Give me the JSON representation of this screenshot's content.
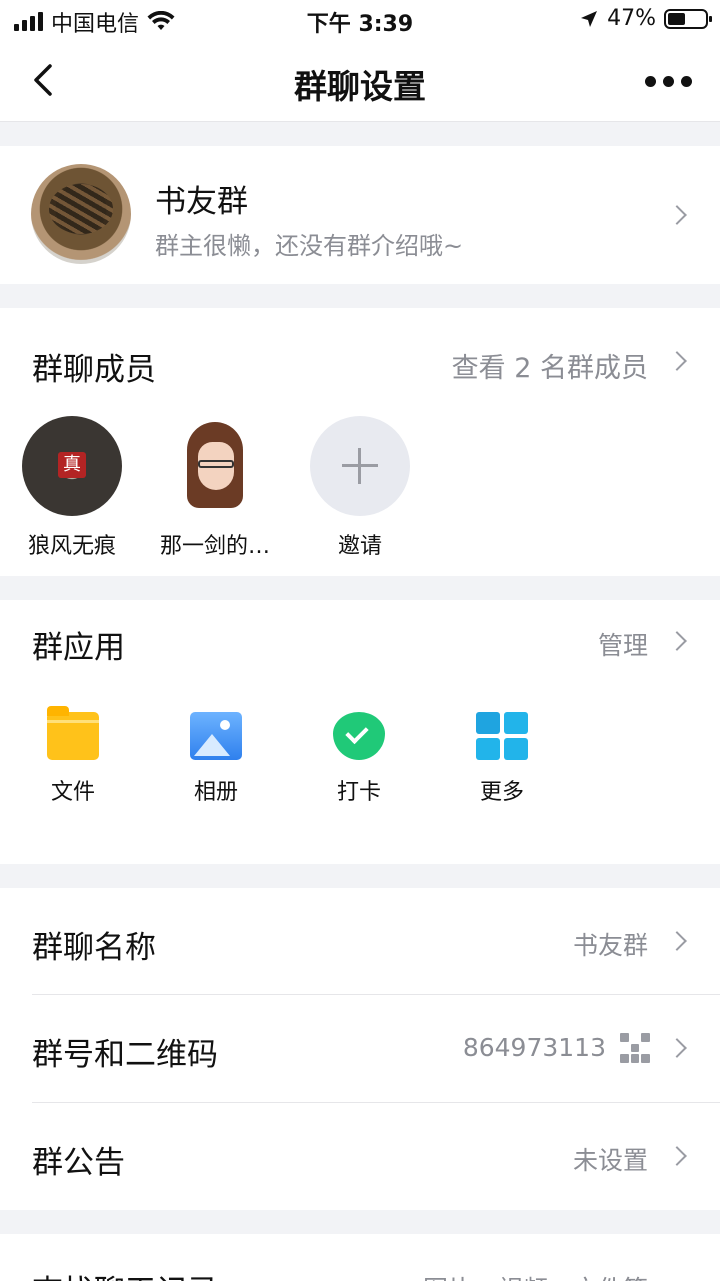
{
  "status_bar": {
    "carrier": "中国电信",
    "time": "下午 3:39",
    "battery_percent": "47%",
    "battery_level": 0.47
  },
  "nav": {
    "title": "群聊设置",
    "back_icon": "chevron-left-icon",
    "more_icon": "ellipsis-icon"
  },
  "group": {
    "name": "书友群",
    "intro": "群主很懒，还没有群介绍哦~"
  },
  "members": {
    "title": "群聊成员",
    "view_all": "查看 2 名群成员",
    "items": [
      {
        "name": "狼风无痕",
        "badge": "真"
      },
      {
        "name": "那一剑的…"
      },
      {
        "name": "邀请"
      }
    ]
  },
  "apps": {
    "title": "群应用",
    "manage": "管理",
    "items": [
      {
        "label": "文件",
        "icon": "folder-icon"
      },
      {
        "label": "相册",
        "icon": "album-icon"
      },
      {
        "label": "打卡",
        "icon": "check-in-icon"
      },
      {
        "label": "更多",
        "icon": "grid-icon"
      }
    ]
  },
  "settings": {
    "group_name": {
      "label": "群聊名称",
      "value": "书友群"
    },
    "group_number": {
      "label": "群号和二维码",
      "value": "864973113"
    },
    "announcement": {
      "label": "群公告",
      "value": "未设置"
    }
  },
  "partial_row": {
    "label": "查找聊天记录",
    "value": "图片、视频、文件等"
  },
  "colors": {
    "background": "#f2f3f6",
    "secondary_text": "#8b8d94",
    "check_green": "#20c978",
    "folder_yellow": "#ffc21a",
    "album_blue": "#2f80ed",
    "more_blue": "#22b4ea"
  }
}
